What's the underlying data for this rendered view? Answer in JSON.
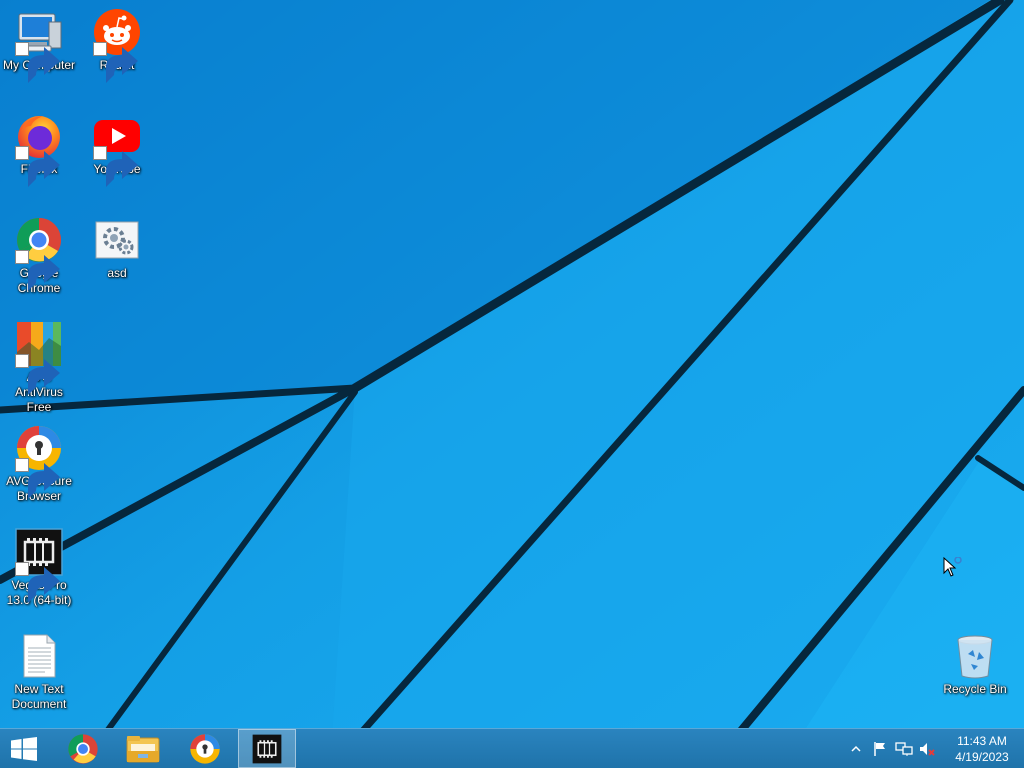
{
  "desktop": {
    "icons": [
      {
        "label": "My Computer",
        "icon": "computer-icon"
      },
      {
        "label": "Reddit",
        "icon": "reddit-icon"
      },
      {
        "label": "Firefox",
        "icon": "firefox-icon"
      },
      {
        "label": "YouTube",
        "icon": "youtube-icon"
      },
      {
        "label": "Google Chrome",
        "icon": "chrome-icon"
      },
      {
        "label": "asd",
        "icon": "settings-file-icon"
      },
      {
        "label": "AVG AntiVirus Free",
        "icon": "avg-antivirus-icon"
      },
      {
        "label": "AVG Secure Browser",
        "icon": "avg-browser-icon"
      },
      {
        "label": "Vegas Pro 13.0 (64-bit)",
        "icon": "vegas-pro-icon"
      },
      {
        "label": "New Text Document",
        "icon": "text-document-icon"
      },
      {
        "label": "Recycle Bin",
        "icon": "recycle-bin-icon"
      }
    ]
  },
  "taskbar": {
    "start": {
      "icon": "windows-start-icon"
    },
    "pinned": [
      {
        "icon": "chrome-icon"
      },
      {
        "icon": "file-explorer-icon"
      },
      {
        "icon": "avg-browser-icon"
      },
      {
        "icon": "vegas-pro-icon",
        "active": true
      }
    ],
    "tray": {
      "icons": [
        "show-hidden-icons-icon",
        "action-center-flag-icon",
        "network-icon",
        "volume-muted-icon"
      ],
      "time": "11:43 AM",
      "date": "4/19/2023"
    }
  },
  "colors": {
    "wallpaper_light": "#17a9ef",
    "wallpaper_dark": "#0a78c8",
    "taskbar": "#1f73aa"
  }
}
